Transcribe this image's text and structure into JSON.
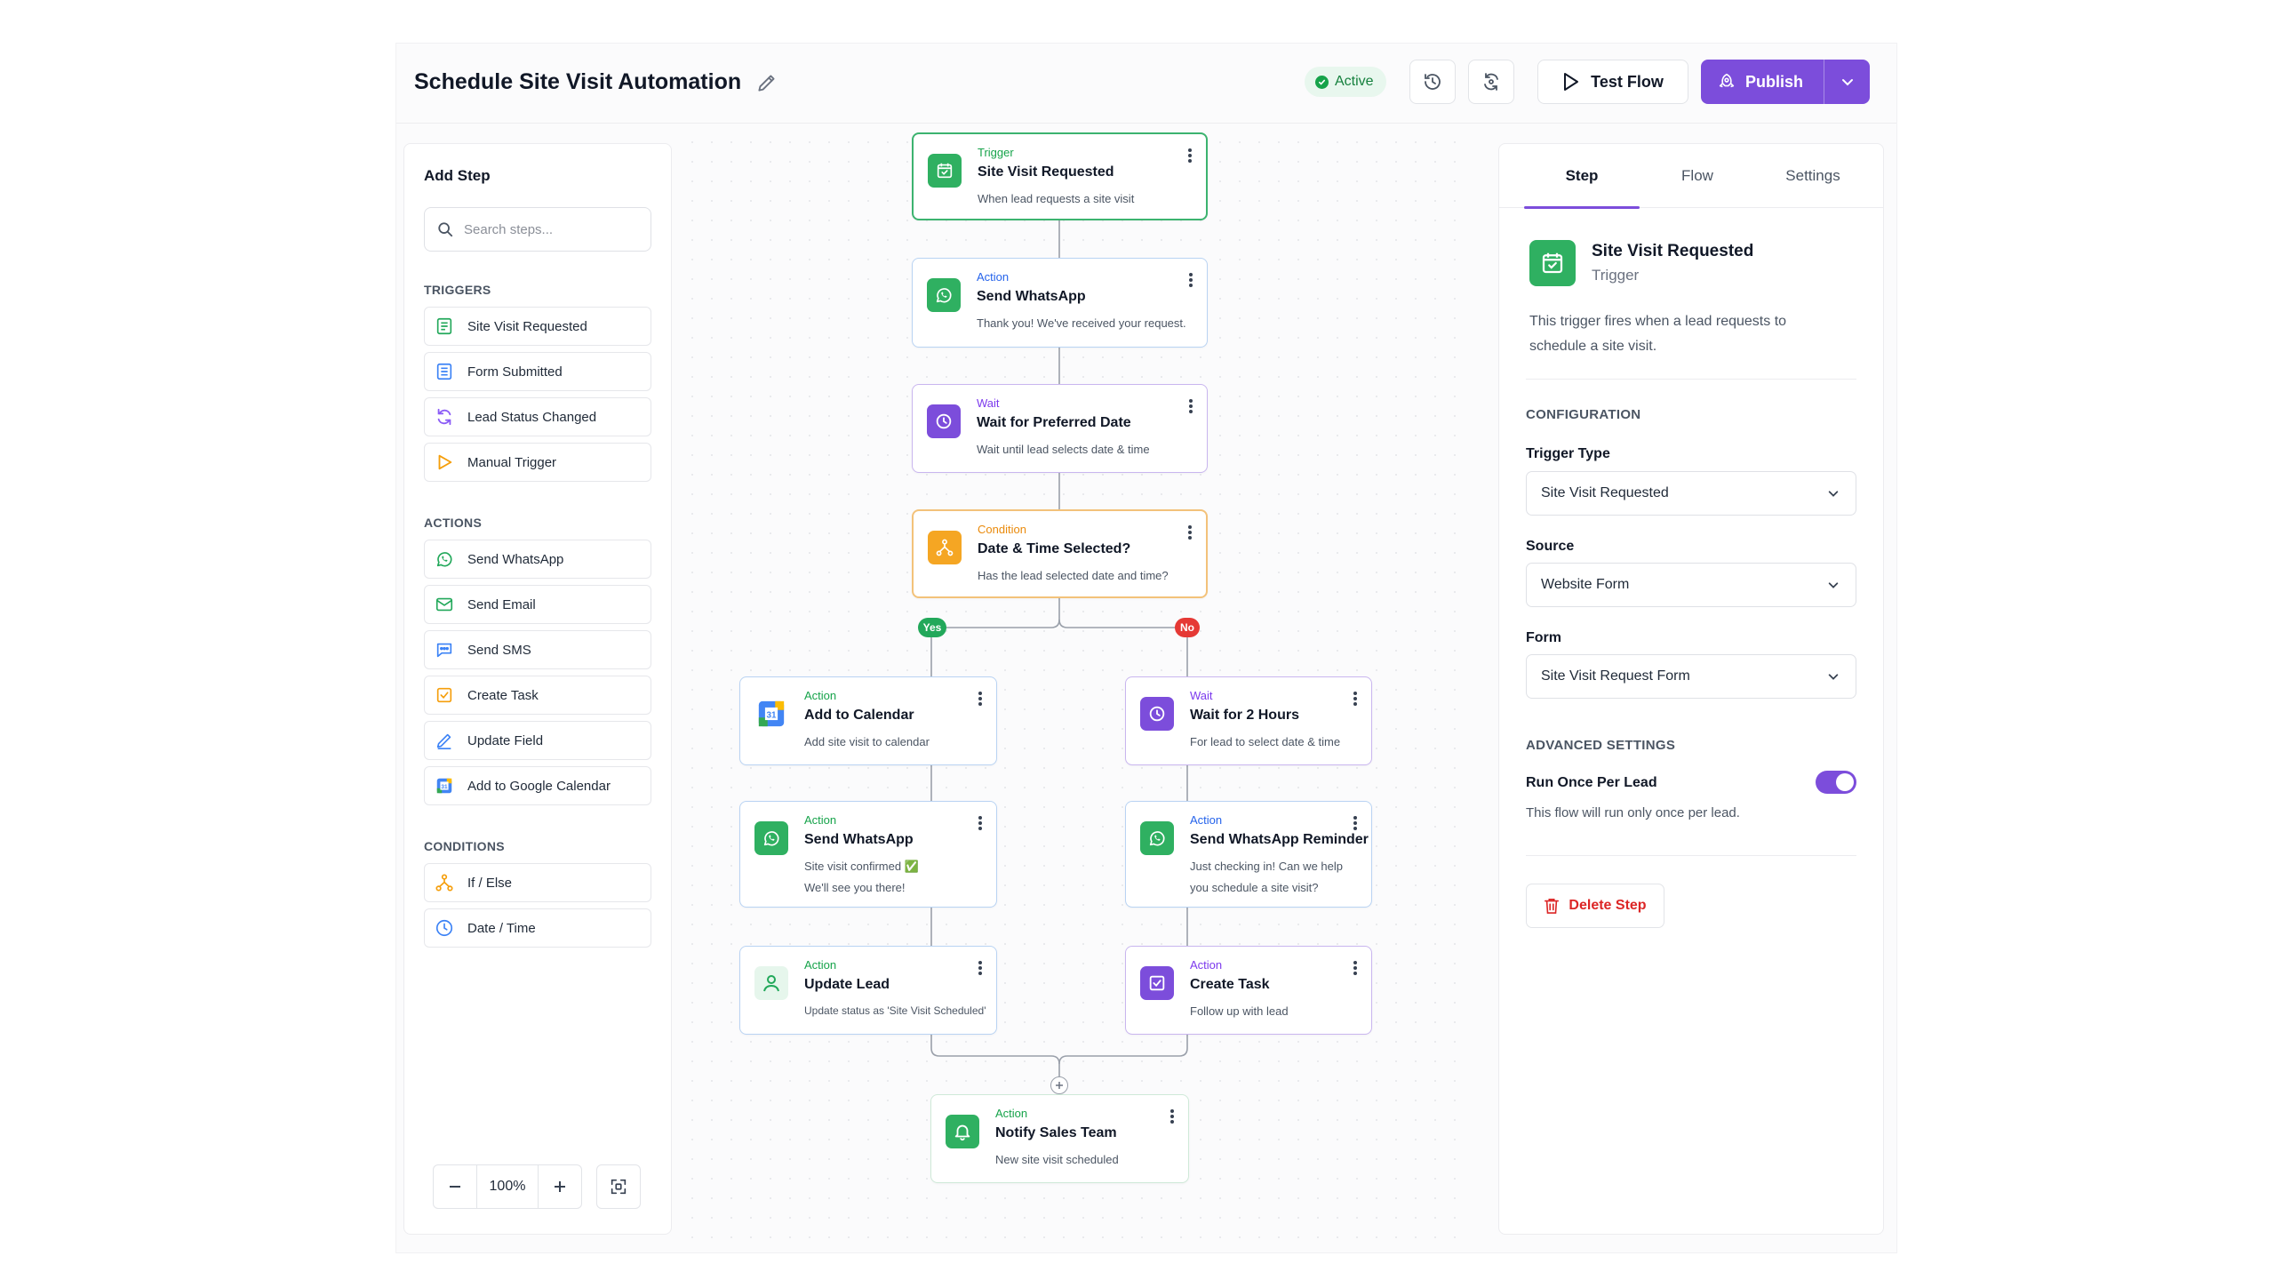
{
  "header": {
    "title": "Schedule Site Visit Automation",
    "status": "Active",
    "test_flow": "Test Flow",
    "publish": "Publish"
  },
  "left_panel": {
    "title": "Add Step",
    "search_placeholder": "Search steps...",
    "sections": {
      "triggers": "TRIGGERS",
      "actions": "ACTIONS",
      "conditions": "CONDITIONS"
    },
    "triggers": [
      {
        "label": "Site Visit Requested",
        "icon": "calendar-icon"
      },
      {
        "label": "Form Submitted",
        "icon": "form-icon"
      },
      {
        "label": "Lead Status Changed",
        "icon": "refresh-icon"
      },
      {
        "label": "Manual Trigger",
        "icon": "play-icon"
      }
    ],
    "actions": [
      {
        "label": "Send WhatsApp",
        "icon": "whatsapp-icon"
      },
      {
        "label": "Send Email",
        "icon": "mail-icon"
      },
      {
        "label": "Send SMS",
        "icon": "message-icon"
      },
      {
        "label": "Create Task",
        "icon": "task-icon"
      },
      {
        "label": "Update Field",
        "icon": "pencil-icon"
      },
      {
        "label": "Add to Google Calendar",
        "icon": "google-calendar-icon"
      }
    ],
    "conditions": [
      {
        "label": "If / Else",
        "icon": "branch-icon"
      },
      {
        "label": "Date / Time",
        "icon": "clock-icon"
      }
    ],
    "zoom": "100%"
  },
  "flow": {
    "nodes": [
      {
        "type": "Trigger",
        "title": "Site Visit Requested",
        "desc": "When lead requests a site visit"
      },
      {
        "type": "Action",
        "title": "Send WhatsApp",
        "desc": "Thank you! We've received your request."
      },
      {
        "type": "Wait",
        "title": "Wait for Preferred Date",
        "desc": "Wait until lead selects date & time"
      },
      {
        "type": "Condition",
        "title": "Date & Time Selected?",
        "desc": "Has the lead selected date and time?"
      },
      {
        "type": "Action",
        "title": "Add to Calendar",
        "desc": "Add site visit to calendar"
      },
      {
        "type": "Action",
        "title": "Send WhatsApp",
        "desc": "Site visit confirmed ✅",
        "desc2": "We'll see you there!"
      },
      {
        "type": "Action",
        "title": "Update Lead",
        "desc": "Update status as 'Site Visit Scheduled'"
      },
      {
        "type": "Wait",
        "title": "Wait for 2 Hours",
        "desc": "For lead to select date & time"
      },
      {
        "type": "Action",
        "title": "Send WhatsApp Reminder",
        "desc": "Just checking in! Can we help",
        "desc2": "you schedule a site visit?"
      },
      {
        "type": "Action",
        "title": "Create Task",
        "desc": "Follow up with lead"
      },
      {
        "type": "Action",
        "title": "Notify Sales Team",
        "desc": "New site visit scheduled"
      }
    ],
    "branch_yes": "Yes",
    "branch_no": "No"
  },
  "right_panel": {
    "tabs": [
      "Step",
      "Flow",
      "Settings"
    ],
    "selected_title": "Site Visit Requested",
    "selected_type": "Trigger",
    "description": "This trigger fires when a lead requests to schedule a site visit.",
    "configuration": "CONFIGURATION",
    "trigger_type_label": "Trigger Type",
    "trigger_type_value": "Site Visit Requested",
    "source_label": "Source",
    "source_value": "Website Form",
    "form_label": "Form",
    "form_value": "Site Visit Request Form",
    "advanced": "ADVANCED SETTINGS",
    "run_once_label": "Run Once Per Lead",
    "run_once_enabled": true,
    "run_once_hint": "This flow will run only once per lead.",
    "delete": "Delete Step"
  },
  "colors": {
    "accent": "#7c4ddb",
    "success": "#16a34a",
    "danger": "#dc2626",
    "wait": "#7c3aed",
    "condition": "#f59e0b"
  }
}
